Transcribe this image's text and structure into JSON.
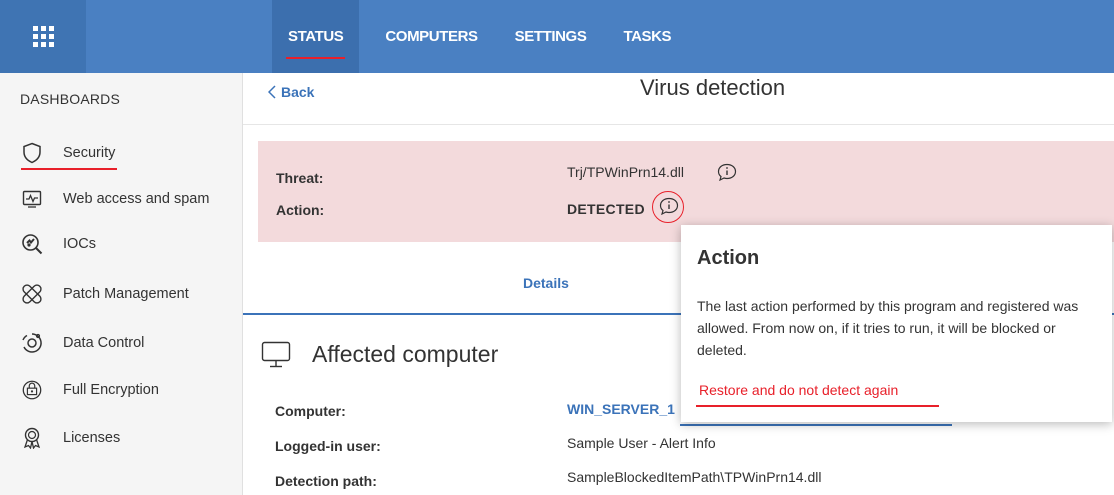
{
  "topbar": {
    "nav": [
      "STATUS",
      "COMPUTERS",
      "SETTINGS",
      "TASKS"
    ],
    "active": "STATUS"
  },
  "sidebar": {
    "header": "DASHBOARDS",
    "items": [
      {
        "label": "Security",
        "icon": "shield-icon"
      },
      {
        "label": "Web access and spam",
        "icon": "web-traffic-icon"
      },
      {
        "label": "IOCs",
        "icon": "ioc-search-icon"
      },
      {
        "label": "Patch Management",
        "icon": "patch-icon"
      },
      {
        "label": "Data Control",
        "icon": "data-control-icon"
      },
      {
        "label": "Full Encryption",
        "icon": "disk-encryption-icon"
      },
      {
        "label": "Licenses",
        "icon": "license-badge-icon"
      }
    ]
  },
  "main": {
    "back_label": "Back",
    "title": "Virus detection",
    "alert": {
      "threat_label": "Threat:",
      "threat_value": "Trj/TPWinPrn14.dll",
      "action_label": "Action:",
      "action_value": "DETECTED"
    },
    "tab": "Details",
    "section_title": "Affected computer",
    "rows": [
      {
        "label": "Computer:",
        "value": "WIN_SERVER_1"
      },
      {
        "label": "Logged-in user:",
        "value": "Sample User - Alert Info"
      },
      {
        "label": "Detection path:",
        "value": "SampleBlockedItemPath\\TPWinPrn14.dll"
      }
    ]
  },
  "popover": {
    "title": "Action",
    "body": "The last action performed by this program and registered was allowed. From now on, if it tries to run, it will be blocked or deleted.",
    "link": "Restore and do not detect again"
  },
  "colors": {
    "topbar": "#4a80c2",
    "accent_red": "#e8202a",
    "link_blue": "#3b73b9",
    "alert_bg": "#f3dadc"
  }
}
